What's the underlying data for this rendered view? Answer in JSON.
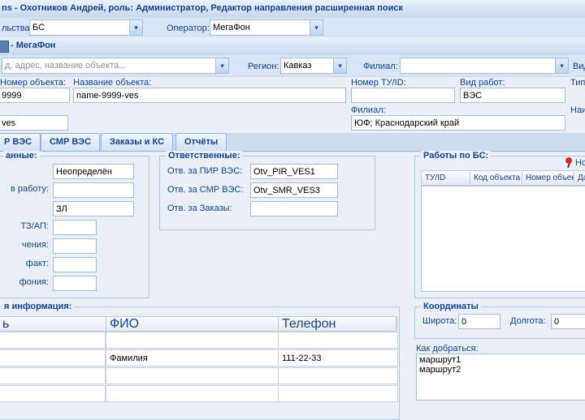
{
  "title_bar": {
    "text": "ns - Охотников Андрей, роль: Администратор, Редактор направления расширенная поиск"
  },
  "filter_row": {
    "construction_label": "льства:",
    "construction_value": "БС",
    "operator_label": "Оператор:",
    "operator_value": "МегаФон"
  },
  "section_bar": {
    "text": "- МегаФон"
  },
  "search_row": {
    "search_placeholder": "д, адрес, название объекта...",
    "region_label": "Регион:",
    "region_value": "Кавказ",
    "branch_label": "Филиал:",
    "branch_value": "",
    "right_label": "Вид"
  },
  "object_form": {
    "number_label": "Номер объекта:",
    "number_value": "9999",
    "name_label": "Название объекта:",
    "name_value": "name-9999-ves",
    "tu_label": "Номер ТУ/ID:",
    "tu_value": "",
    "worktype_label": "Вид работ:",
    "worktype_value": "ВЭС",
    "type_label": "Тип р",
    "code_value": "ves",
    "branch_label": "Филиал:",
    "branch_value": "ЮФ; Краснодарский край",
    "name2_label": "Наим"
  },
  "tabs": {
    "items": [
      "Р ВЭС",
      "СМР ВЭС",
      "Заказы и КС",
      "Отчёты"
    ]
  },
  "new_button": {
    "label": "Нов"
  },
  "general": {
    "legend": "анные:",
    "rows": [
      {
        "label": "",
        "value": "Неопределён"
      },
      {
        "label": "в работу:",
        "value": ""
      },
      {
        "label": "",
        "value": "ЗЛ"
      },
      {
        "label": "ТЗ/АП:",
        "value": ""
      },
      {
        "label": "чения:",
        "value": ""
      },
      {
        "label": "факт:",
        "value": ""
      },
      {
        "label": "фония:",
        "value": ""
      }
    ]
  },
  "responsible": {
    "legend": "Ответственные:",
    "rows": [
      {
        "label": "Отв. за ПИР ВЭС:",
        "value": "Otv_PIR_VES1"
      },
      {
        "label": "Отв. за СМР ВЭС:",
        "value": "Otv_SMR_VES3"
      },
      {
        "label": "Отв. за Заказы:",
        "value": ""
      }
    ]
  },
  "works": {
    "legend": "Работы по БС:",
    "columns": [
      "ТУ/ID",
      "Код объекта",
      "Номер объекта",
      "Дат"
    ]
  },
  "contacts": {
    "legend": "я информация:",
    "columns": [
      "ь",
      "ФИО",
      "Телефон"
    ],
    "rows": [
      [
        "",
        "",
        ""
      ],
      [
        "",
        "Фамилия",
        "111-22-33"
      ],
      [
        "",
        "",
        ""
      ],
      [
        "",
        "",
        ""
      ]
    ]
  },
  "coordinates": {
    "legend": "Координаты",
    "lat_label": "Широта:",
    "lat_value": "0",
    "lon_label": "Долгота:",
    "lon_value": "0"
  },
  "directions": {
    "label": "Как добраться:",
    "text": "маршрут1\nмаршрут2"
  },
  "colors": {
    "accent": "#15428b",
    "pin": "#d42b2b"
  }
}
